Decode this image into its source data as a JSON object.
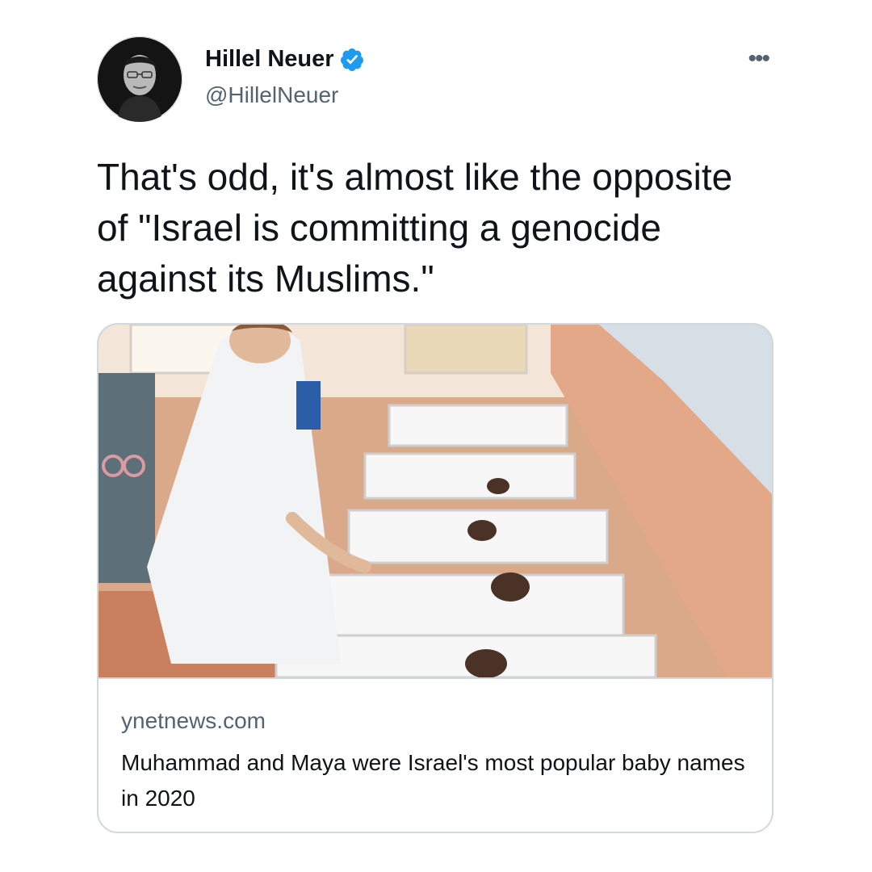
{
  "author": {
    "name": "Hillel Neuer",
    "handle": "@HillelNeuer",
    "verified": true,
    "avatar_icon": "profile-photo"
  },
  "menu": {
    "more_label": "•••"
  },
  "tweet": {
    "text": "That's odd, it's almost like the opposite of \"Israel is committing a genocide against its Muslims.\""
  },
  "link_card": {
    "image_icon": "nursery-photo",
    "domain": "ynetnews.com",
    "title": "Muhammad and Maya were Israel's most popular baby names in 2020"
  },
  "colors": {
    "text_primary": "#0f1419",
    "text_secondary": "#536471",
    "verified_blue": "#1d9bf0",
    "card_border": "#cfd9de"
  }
}
